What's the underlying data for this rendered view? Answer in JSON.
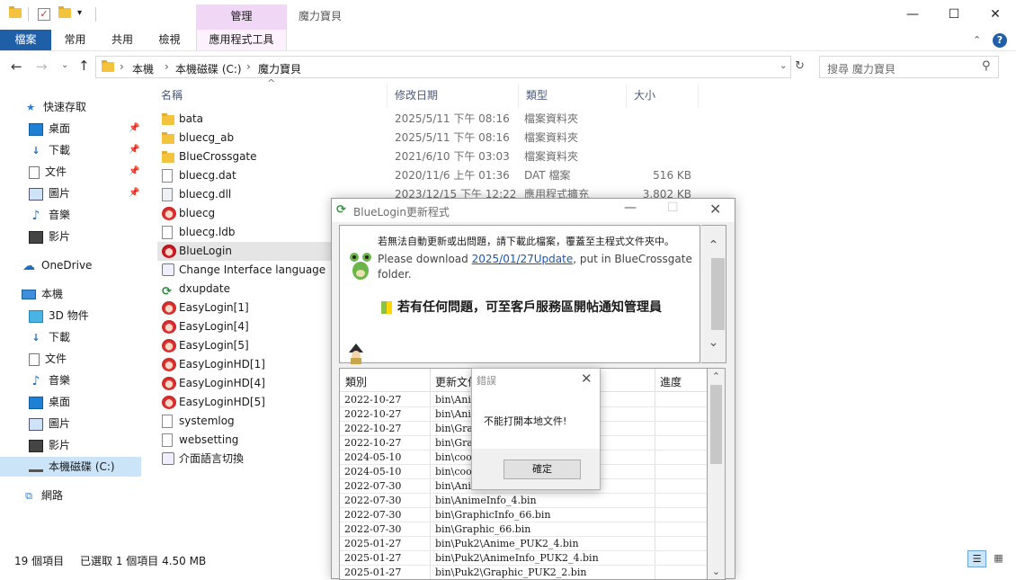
{
  "window": {
    "ribbon_context_label": "管理",
    "title": "魔力寶貝",
    "controls": {
      "minimize": "—",
      "maximize": "☐",
      "close": "✕"
    }
  },
  "ribbon": {
    "tabs": [
      "檔案",
      "常用",
      "共用",
      "檢視",
      "應用程式工具"
    ],
    "help": "?"
  },
  "address": {
    "path": [
      "本機",
      "本機磁碟 (C:)",
      "魔力寶貝"
    ],
    "search_placeholder": "搜尋 魔力寶貝"
  },
  "nav": {
    "quick_access": "快速存取",
    "quick_items": [
      "桌面",
      "下載",
      "文件",
      "圖片",
      "音樂",
      "影片"
    ],
    "onedrive": "OneDrive",
    "this_pc": "本機",
    "pc_items": [
      "3D 物件",
      "下載",
      "文件",
      "音樂",
      "桌面",
      "圖片",
      "影片",
      "本機磁碟 (C:)"
    ],
    "network": "網路"
  },
  "columns": {
    "name": "名稱",
    "date": "修改日期",
    "type": "類型",
    "size": "大小"
  },
  "files": [
    {
      "name": "bata",
      "date": "2025/5/11 下午 08:16",
      "type": "檔案資料夾",
      "size": "",
      "icon": "folder-icon"
    },
    {
      "name": "bluecg_ab",
      "date": "2025/5/11 下午 08:16",
      "type": "檔案資料夾",
      "size": "",
      "icon": "folder-icon"
    },
    {
      "name": "BlueCrossgate",
      "date": "2021/6/10 下午 03:03",
      "type": "檔案資料夾",
      "size": "",
      "icon": "folder-icon"
    },
    {
      "name": "bluecg.dat",
      "date": "2020/11/6 上午 01:36",
      "type": "DAT 檔案",
      "size": "516 KB",
      "icon": "file-icon"
    },
    {
      "name": "bluecg.dll",
      "date": "2023/12/15 下午 12:22",
      "type": "應用程式擴充",
      "size": "3,802 KB",
      "icon": "dll-icon"
    },
    {
      "name": "bluecg",
      "date": "",
      "type": "",
      "size": "",
      "icon": "game-icon"
    },
    {
      "name": "bluecg.ldb",
      "date": "",
      "type": "",
      "size": "",
      "icon": "file-icon"
    },
    {
      "name": "BlueLogin",
      "date": "",
      "type": "",
      "size": "",
      "icon": "bluelogin-icon"
    },
    {
      "name": "Change Interface language",
      "date": "",
      "type": "",
      "size": "",
      "icon": "settings-icon"
    },
    {
      "name": "dxupdate",
      "date": "",
      "type": "",
      "size": "",
      "icon": "update-icon"
    },
    {
      "name": "EasyLogin[1]",
      "date": "",
      "type": "",
      "size": "",
      "icon": "game-icon"
    },
    {
      "name": "EasyLogin[4]",
      "date": "",
      "type": "",
      "size": "",
      "icon": "game-icon"
    },
    {
      "name": "EasyLogin[5]",
      "date": "",
      "type": "",
      "size": "",
      "icon": "game-icon"
    },
    {
      "name": "EasyLoginHD[1]",
      "date": "",
      "type": "",
      "size": "",
      "icon": "game-icon"
    },
    {
      "name": "EasyLoginHD[4]",
      "date": "",
      "type": "",
      "size": "",
      "icon": "game-icon"
    },
    {
      "name": "EasyLoginHD[5]",
      "date": "",
      "type": "",
      "size": "",
      "icon": "game-icon"
    },
    {
      "name": "systemlog",
      "date": "",
      "type": "",
      "size": "",
      "icon": "text-file-icon"
    },
    {
      "name": "websetting",
      "date": "",
      "type": "",
      "size": "",
      "icon": "text-file-icon"
    },
    {
      "name": "介面語言切換",
      "date": "",
      "type": "",
      "size": "",
      "icon": "settings-icon"
    }
  ],
  "status": {
    "count": "19 個項目",
    "selected": "已選取 1 個項目  4.50 MB"
  },
  "bluelogin": {
    "title": "BlueLogin更新程式",
    "msg_zh": "若無法自動更新或出問題，請下載此檔案，覆蓋至主程式文件夾中。",
    "msg_en_pre": "Please download ",
    "msg_en_link": "2025/01/27Update",
    "msg_en_post": ", put in BlueCrossgate folder.",
    "notice": "若有任何問題，可至客戶服務區開帖通知管理員",
    "table_headers": [
      "類別",
      "更新文件",
      "進度"
    ],
    "rows": [
      {
        "date": "2022-10-27",
        "file": "bin\\Anim"
      },
      {
        "date": "2022-10-27",
        "file": "bin\\Anim"
      },
      {
        "date": "2022-10-27",
        "file": "bin\\Graph"
      },
      {
        "date": "2022-10-27",
        "file": "bin\\Graph"
      },
      {
        "date": "2024-05-10",
        "file": "bin\\coord"
      },
      {
        "date": "2024-05-10",
        "file": "bin\\coord"
      },
      {
        "date": "2022-07-30",
        "file": "bin\\Anim"
      },
      {
        "date": "2022-07-30",
        "file": "bin\\AnimeInfo_4.bin"
      },
      {
        "date": "2022-07-30",
        "file": "bin\\GraphicInfo_66.bin"
      },
      {
        "date": "2022-07-30",
        "file": "bin\\Graphic_66.bin"
      },
      {
        "date": "2025-01-27",
        "file": "bin\\Puk2\\Anime_PUK2_4.bin"
      },
      {
        "date": "2025-01-27",
        "file": "bin\\Puk2\\AnimeInfo_PUK2_4.bin"
      },
      {
        "date": "2025-01-27",
        "file": "bin\\Puk2\\Graphic_PUK2_2.bin"
      }
    ]
  },
  "error": {
    "title": "錯誤",
    "message": "不能打開本地文件!",
    "ok": "確定"
  }
}
